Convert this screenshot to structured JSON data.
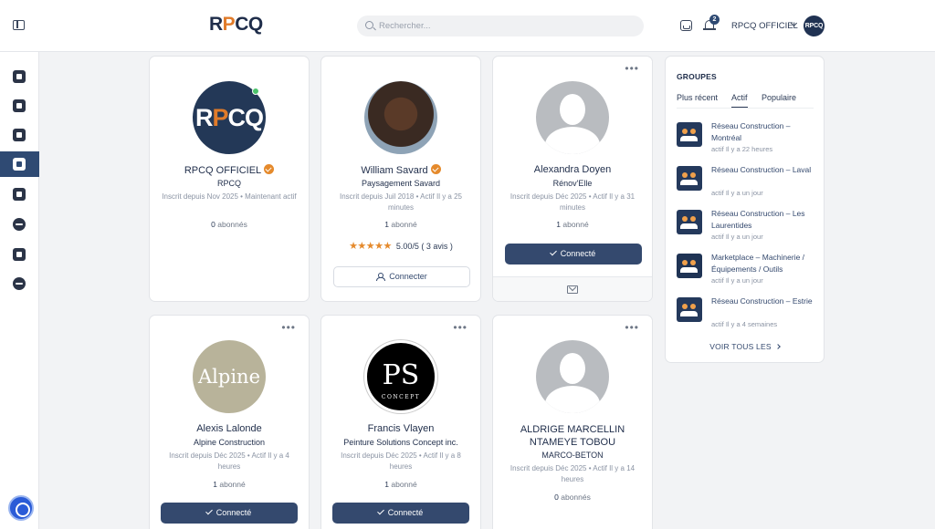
{
  "header": {
    "logo": "RPCQ",
    "search_placeholder": "Rechercher...",
    "notification_count": "2",
    "user_name": "RPCQ OFFICIEL",
    "avatar_text": "RPCQ"
  },
  "sidebar": {
    "items": [
      {
        "icon": "sidebar-toggle-icon"
      },
      {
        "icon": "newsfeed-icon"
      },
      {
        "icon": "profile-icon"
      },
      {
        "icon": "groups-icon"
      },
      {
        "icon": "members-icon",
        "active": true
      },
      {
        "icon": "marketplace-icon"
      },
      {
        "icon": "add-icon"
      },
      {
        "icon": "library-icon"
      },
      {
        "icon": "send-icon"
      }
    ]
  },
  "members": [
    {
      "name": "RPCQ OFFICIEL",
      "verified": true,
      "company": "RPCQ",
      "meta": "Inscrit depuis Nov 2025 • Maintenant actif",
      "subs_count": "0",
      "subs_label": "abonnés",
      "avatar": "RPCQ"
    },
    {
      "name": "William Savard",
      "verified": true,
      "company": "Paysagement Savard",
      "meta": "Inscrit depuis Juil 2018 • Actif Il y a 25 minutes",
      "subs_count": "1",
      "subs_label": "abonné",
      "rating": "5.00/5 ( 3 avis )",
      "stars": "★★★★★",
      "button": "Connecter"
    },
    {
      "name": "Alexandra Doyen",
      "company": "Rénov'Elle",
      "meta": "Inscrit depuis Déc 2025 • Actif Il y a 31 minutes",
      "subs_count": "1",
      "subs_label": "abonné",
      "button": "Connecté"
    },
    {
      "name": "Alexis Lalonde",
      "company": "Alpine Construction",
      "meta": "Inscrit depuis Déc 2025 • Actif Il y a 4 heures",
      "subs_count": "1",
      "subs_label": "abonné",
      "button": "Connecté",
      "avatar": "Alpine"
    },
    {
      "name": "Francis Vlayen",
      "company": "Peinture Solutions Concept inc.",
      "meta": "Inscrit depuis Déc 2025 • Actif Il y a 8 heures",
      "subs_count": "1",
      "subs_label": "abonné",
      "button": "Connecté",
      "avatar": "PS",
      "avatar_sub": "CONCEPT"
    },
    {
      "name": "ALDRIGE MARCELLIN NTAMEYE TOBOU",
      "company": "MARCO-BETON",
      "meta": "Inscrit depuis Déc 2025 • Actif Il y a 14 heures",
      "subs_count": "0",
      "subs_label": "abonnés"
    }
  ],
  "groups": {
    "title": "GROUPES",
    "tabs": [
      "Plus récent",
      "Actif",
      "Populaire"
    ],
    "active_tab": "Actif",
    "items": [
      {
        "name": "Réseau Construction – Montréal",
        "meta": "actif Il y a 22 heures"
      },
      {
        "name": "Réseau Construction – Laval",
        "meta": "actif Il y a un jour"
      },
      {
        "name": "Réseau Construction – Les Laurentides",
        "meta": "actif Il y a un jour"
      },
      {
        "name": "Marketplace – Machinerie / Équipements / Outils",
        "meta": "actif Il y a un jour"
      },
      {
        "name": "Réseau Construction – Estrie",
        "meta": "actif Il y a 4 semaines"
      }
    ],
    "see_all": "VOIR TOUS LES"
  },
  "colors": {
    "primary": "#34496e",
    "accent": "#e58a2c",
    "online": "#4cc36b"
  }
}
